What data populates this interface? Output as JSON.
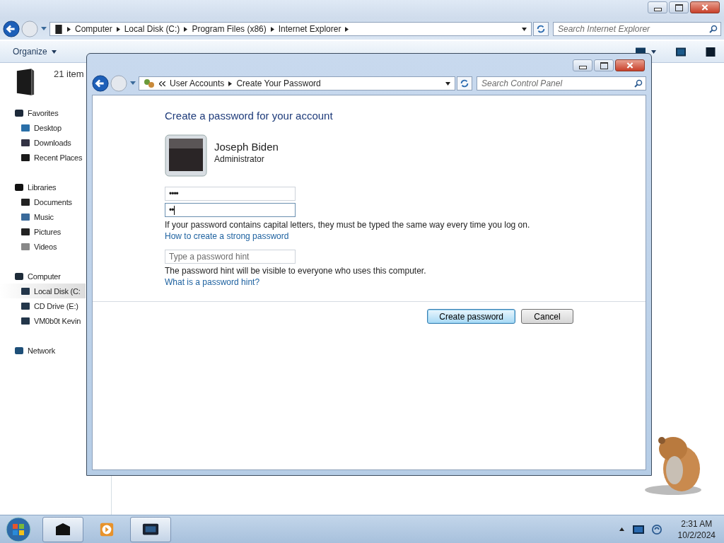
{
  "explorer": {
    "breadcrumb": [
      "Computer",
      "Local Disk (C:)",
      "Program Files (x86)",
      "Internet Explorer"
    ],
    "search": {
      "placeholder": "Search Internet Explorer"
    },
    "toolbar": [
      "Organize"
    ],
    "item_count": "21 item",
    "nav": [
      {
        "label": "Favorites",
        "kind": "star",
        "selected": false,
        "children": [
          {
            "label": "Desktop",
            "kind": "desktop",
            "selected": false
          },
          {
            "label": "Downloads",
            "kind": "download",
            "selected": false
          },
          {
            "label": "Recent Places",
            "kind": "recent",
            "selected": false
          }
        ]
      },
      {
        "label": "Libraries",
        "kind": "library",
        "selected": false,
        "children": [
          {
            "label": "Documents",
            "kind": "doc",
            "selected": false
          },
          {
            "label": "Music",
            "kind": "music",
            "selected": false
          },
          {
            "label": "Pictures",
            "kind": "pictures",
            "selected": false
          },
          {
            "label": "Videos",
            "kind": "video",
            "selected": false
          }
        ]
      },
      {
        "label": "Computer",
        "kind": "computer",
        "selected": false,
        "children": [
          {
            "label": "Local Disk (C:",
            "kind": "drive",
            "selected": true
          },
          {
            "label": "CD Drive (E:)",
            "kind": "drive",
            "selected": false
          },
          {
            "label": "VM0b0t Kevin",
            "kind": "drive",
            "selected": false
          }
        ]
      },
      {
        "label": "Network",
        "kind": "network",
        "selected": false
      }
    ]
  },
  "dialog": {
    "breadcrumb": [
      "User Accounts",
      "Create Your Password"
    ],
    "search": {
      "placeholder": "Search Control Panel"
    },
    "heading": "Create a password for your account",
    "user": {
      "name": "Joseph Biden",
      "role": "Administrator"
    },
    "password_fields": [
      {
        "value": "••••",
        "focused": false
      },
      {
        "value": "••",
        "focused": true
      }
    ],
    "caps_note": "If your password contains capital letters, they must be typed the same way every time you log on.",
    "strong_link": "How to create a strong password",
    "hint": {
      "placeholder": "Type a password hint"
    },
    "hint_note": "The password hint will be visible to everyone who uses this computer.",
    "hint_link": "What is a password hint?",
    "buttons": [
      {
        "label": "Create password",
        "default": true
      },
      {
        "label": "Cancel",
        "default": false
      }
    ]
  },
  "taskbar": {
    "apps": [
      {
        "kind": "folder",
        "active": true
      },
      {
        "kind": "player",
        "active": false
      },
      {
        "kind": "screen",
        "active": true
      }
    ],
    "time": "2:31 AM",
    "date": "10/2/2024"
  }
}
